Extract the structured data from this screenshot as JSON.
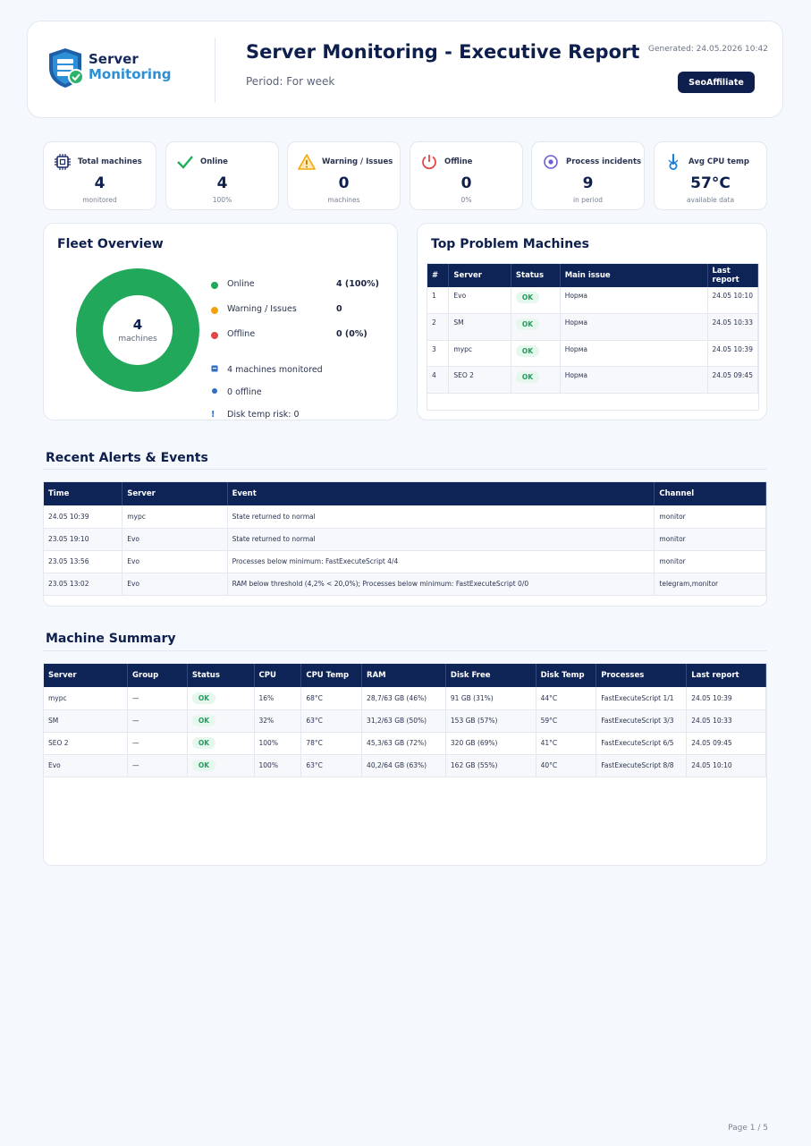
{
  "header": {
    "logo_line1": "Server",
    "logo_line2": "Monitoring",
    "title": "Server Monitoring - Executive Report",
    "period": "Period: For week",
    "generated": "Generated: 24.05.2026 10:42",
    "brand": "SeoAffiliate"
  },
  "kpis": [
    {
      "label": "Total machines",
      "value": "4",
      "sub": "monitored",
      "icon": "chip-icon",
      "color": "#1b2a6b"
    },
    {
      "label": "Online",
      "value": "4",
      "sub": "100%",
      "icon": "check-icon",
      "color": "#1eae5a"
    },
    {
      "label": "Warning / Issues",
      "value": "0",
      "sub": "machines",
      "icon": "warning-icon",
      "color": "#f2a80c"
    },
    {
      "label": "Offline",
      "value": "0",
      "sub": "0%",
      "icon": "power-icon",
      "color": "#e04848"
    },
    {
      "label": "Process incidents",
      "value": "9",
      "sub": "in period",
      "icon": "target-icon",
      "color": "#6a5fd2"
    },
    {
      "label": "Avg CPU temp",
      "value": "57°C",
      "sub": "available data",
      "icon": "thermometer-icon",
      "color": "#1e7fd8"
    }
  ],
  "fleet": {
    "title": "Fleet Overview",
    "center_value": "4",
    "center_label": "machines",
    "legend": [
      {
        "label": "Online",
        "value": "4 (100%)",
        "color": "#22a85a"
      },
      {
        "label": "Warning / Issues",
        "value": "0",
        "color": "#f2a20c"
      },
      {
        "label": "Offline",
        "value": "0 (0%)",
        "color": "#e04848"
      }
    ],
    "stats": [
      {
        "icon": "server-icon",
        "text": "4 machines monitored"
      },
      {
        "icon": "dot-icon",
        "text": "0 offline"
      },
      {
        "icon": "exclamation-icon",
        "text": "Disk temp risk: 0"
      }
    ],
    "online_fraction": 1.0
  },
  "problems": {
    "title": "Top Problem Machines",
    "columns": [
      "#",
      "Server",
      "Status",
      "Main issue",
      "Last report"
    ],
    "rows": [
      [
        "1",
        "Evo",
        "OK",
        "Норма",
        "24.05 10:10"
      ],
      [
        "2",
        "SM",
        "OK",
        "Норма",
        "24.05 10:33"
      ],
      [
        "3",
        "mypc",
        "OK",
        "Норма",
        "24.05 10:39"
      ],
      [
        "4",
        "SEO 2",
        "OK",
        "Норма",
        "24.05 09:45"
      ]
    ]
  },
  "alerts": {
    "title": "Recent Alerts & Events",
    "columns": [
      "Time",
      "Server",
      "Event",
      "Channel"
    ],
    "rows": [
      [
        "24.05 10:39",
        "mypc",
        "State returned to normal",
        "monitor"
      ],
      [
        "23.05 19:10",
        "Evo",
        "State returned to normal",
        "monitor"
      ],
      [
        "23.05 13:56",
        "Evo",
        "Processes below minimum: FastExecuteScript 4/4",
        "monitor"
      ],
      [
        "23.05 13:02",
        "Evo",
        "RAM below threshold (4,2% < 20,0%); Processes below minimum: FastExecuteScript 0/0",
        "telegram,monitor"
      ]
    ]
  },
  "summary": {
    "title": "Machine Summary",
    "columns": [
      "Server",
      "Group",
      "Status",
      "CPU",
      "CPU Temp",
      "RAM",
      "Disk Free",
      "Disk Temp",
      "Processes",
      "Last report"
    ],
    "rows": [
      [
        "mypc",
        "—",
        "OK",
        "16%",
        "68°C",
        "28,7/63 GB (46%)",
        "91 GB (31%)",
        "44°C",
        "FastExecuteScript 1/1",
        "24.05 10:39"
      ],
      [
        "SM",
        "—",
        "OK",
        "32%",
        "63°C",
        "31,2/63 GB (50%)",
        "153 GB (57%)",
        "59°C",
        "FastExecuteScript 3/3",
        "24.05 10:33"
      ],
      [
        "SEO 2",
        "—",
        "OK",
        "100%",
        "78°C",
        "45,3/63 GB (72%)",
        "320 GB (69%)",
        "41°C",
        "FastExecuteScript 6/5",
        "24.05 09:45"
      ],
      [
        "Evo",
        "—",
        "OK",
        "100%",
        "63°C",
        "40,2/64 GB (63%)",
        "162 GB (55%)",
        "40°C",
        "FastExecuteScript 8/8",
        "24.05 10:10"
      ]
    ]
  },
  "footer": {
    "page": "Page 1 / 5"
  }
}
